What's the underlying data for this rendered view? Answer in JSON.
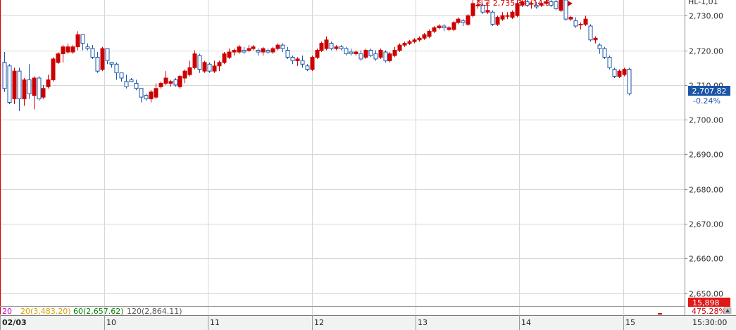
{
  "chart_data": {
    "type": "candlestick",
    "x_labels": [
      "02/03",
      "10",
      "11",
      "12",
      "13",
      "14",
      "15"
    ],
    "time_label": "15:30:00",
    "y_ticks": [
      "2,730.00",
      "2,720.00",
      "2,710.00",
      "2,700.00",
      "2,690.00",
      "2,680.00",
      "2,670.00",
      "2,660.00",
      "2,650.00"
    ],
    "y_tick_values": [
      2730,
      2720,
      2710,
      2700,
      2690,
      2680,
      2670,
      2660,
      2650
    ],
    "ylim": [
      2646.5,
      2734.5
    ],
    "high_annotation": "최고 2,735.34 (14:5",
    "top_right_label": "HL-1,01",
    "current_price": "2,707.82",
    "current_value": 2707.82,
    "change_pct": "-0.24%",
    "volume_value": "15,898",
    "volume_pct": "475.28%",
    "ma_legend": [
      {
        "label": "20",
        "color": "#cc00cc"
      },
      {
        "label": "20(3,483.20)",
        "color": "#d4a000"
      },
      {
        "label": "60(2,657.62)",
        "color": "#008000"
      },
      {
        "label": "120(2,864.11)",
        "color": "#555555"
      }
    ],
    "up_color": "#cc0000",
    "down_color": "#1a55a8",
    "candles": [
      [
        2716.5,
        2709.0,
        2719.5,
        2708.0
      ],
      [
        2715.5,
        2705.0,
        2716.0,
        2704.5
      ],
      [
        2706.0,
        2714.0,
        2715.0,
        2704.5
      ],
      [
        2714.0,
        2706.0,
        2715.0,
        2702.5
      ],
      [
        2706.0,
        2711.5,
        2712.0,
        2704.0
      ],
      [
        2711.5,
        2707.5,
        2716.0,
        2706.0
      ],
      [
        2707.0,
        2712.0,
        2712.5,
        2703.0
      ],
      [
        2712.0,
        2706.0,
        2712.5,
        2705.5
      ],
      [
        2706.5,
        2709.0,
        2710.0,
        2706.0
      ],
      [
        2709.5,
        2711.5,
        2713.0,
        2709.0
      ],
      [
        2711.5,
        2717.5,
        2718.0,
        2711.0
      ],
      [
        2716.5,
        2719.0,
        2719.5,
        2716.0
      ],
      [
        2719.0,
        2721.0,
        2721.5,
        2716.5
      ],
      [
        2719.5,
        2721.0,
        2722.0,
        2719.0
      ],
      [
        2719.5,
        2721.0,
        2721.5,
        2719.0
      ],
      [
        2721.0,
        2724.5,
        2725.5,
        2720.0
      ],
      [
        2724.5,
        2722.0,
        2724.5,
        2720.0
      ],
      [
        2721.0,
        2720.5,
        2722.0,
        2720.0
      ],
      [
        2720.5,
        2718.0,
        2721.5,
        2717.5
      ],
      [
        2718.0,
        2714.0,
        2719.5,
        2713.5
      ],
      [
        2714.5,
        2720.5,
        2721.0,
        2714.0
      ],
      [
        2720.5,
        2717.0,
        2720.5,
        2716.0
      ],
      [
        2716.5,
        2716.0,
        2716.5,
        2715.0
      ],
      [
        2716.0,
        2713.5,
        2716.5,
        2711.5
      ],
      [
        2713.5,
        2712.0,
        2713.5,
        2711.0
      ],
      [
        2711.0,
        2709.5,
        2713.0,
        2709.0
      ],
      [
        2711.5,
        2711.0,
        2712.0,
        2711.0
      ],
      [
        2710.5,
        2709.0,
        2711.5,
        2708.5
      ],
      [
        2709.0,
        2706.5,
        2709.0,
        2705.0
      ],
      [
        2707.0,
        2706.0,
        2707.5,
        2705.5
      ],
      [
        2706.0,
        2708.0,
        2708.5,
        2705.0
      ],
      [
        2706.5,
        2709.0,
        2710.5,
        2706.0
      ],
      [
        2709.5,
        2710.5,
        2711.0,
        2709.0
      ],
      [
        2710.5,
        2712.0,
        2714.0,
        2710.0
      ],
      [
        2710.5,
        2711.0,
        2711.5,
        2709.5
      ],
      [
        2711.5,
        2710.0,
        2712.0,
        2709.5
      ],
      [
        2709.5,
        2712.5,
        2713.0,
        2709.0
      ],
      [
        2712.0,
        2714.0,
        2714.5,
        2710.5
      ],
      [
        2713.0,
        2715.0,
        2717.0,
        2712.5
      ],
      [
        2715.0,
        2719.0,
        2720.0,
        2714.5
      ],
      [
        2718.5,
        2714.5,
        2719.0,
        2713.5
      ],
      [
        2714.0,
        2716.5,
        2717.0,
        2713.5
      ],
      [
        2716.0,
        2714.0,
        2716.5,
        2713.5
      ],
      [
        2714.0,
        2715.5,
        2717.0,
        2713.5
      ],
      [
        2715.5,
        2716.5,
        2717.0,
        2714.0
      ],
      [
        2716.5,
        2719.0,
        2719.5,
        2716.0
      ],
      [
        2718.0,
        2719.5,
        2720.5,
        2717.5
      ],
      [
        2719.5,
        2720.0,
        2720.5,
        2718.5
      ],
      [
        2719.5,
        2721.0,
        2721.5,
        2719.0
      ],
      [
        2720.0,
        2719.5,
        2721.0,
        2719.0
      ],
      [
        2720.0,
        2720.5,
        2721.5,
        2719.5
      ],
      [
        2720.5,
        2721.0,
        2721.5,
        2720.0
      ],
      [
        2720.0,
        2719.5,
        2720.5,
        2718.5
      ],
      [
        2719.5,
        2720.5,
        2721.0,
        2718.5
      ],
      [
        2720.0,
        2719.5,
        2720.5,
        2719.0
      ],
      [
        2719.5,
        2720.5,
        2721.0,
        2719.0
      ],
      [
        2720.5,
        2721.5,
        2722.0,
        2720.0
      ],
      [
        2721.5,
        2720.5,
        2722.0,
        2719.5
      ],
      [
        2720.0,
        2718.0,
        2721.0,
        2717.5
      ],
      [
        2718.0,
        2717.0,
        2718.5,
        2716.0
      ],
      [
        2717.0,
        2717.5,
        2718.0,
        2715.5
      ],
      [
        2717.0,
        2716.0,
        2718.5,
        2715.0
      ],
      [
        2715.5,
        2714.5,
        2716.0,
        2714.0
      ],
      [
        2714.5,
        2718.0,
        2718.5,
        2714.0
      ],
      [
        2718.0,
        2720.0,
        2720.5,
        2717.5
      ],
      [
        2720.0,
        2722.0,
        2722.5,
        2719.5
      ],
      [
        2720.5,
        2723.0,
        2724.0,
        2720.0
      ],
      [
        2722.0,
        2720.5,
        2722.5,
        2720.0
      ],
      [
        2720.5,
        2721.0,
        2721.5,
        2720.0
      ],
      [
        2721.0,
        2720.5,
        2721.5,
        2720.0
      ],
      [
        2720.5,
        2719.0,
        2721.0,
        2718.5
      ],
      [
        2719.5,
        2719.0,
        2720.5,
        2718.5
      ],
      [
        2719.0,
        2719.5,
        2720.0,
        2718.5
      ],
      [
        2719.0,
        2717.5,
        2720.0,
        2717.0
      ],
      [
        2718.0,
        2720.0,
        2720.5,
        2717.5
      ],
      [
        2720.0,
        2718.5,
        2720.5,
        2718.0
      ],
      [
        2719.0,
        2717.5,
        2720.0,
        2717.0
      ],
      [
        2718.0,
        2720.0,
        2720.5,
        2717.5
      ],
      [
        2719.5,
        2717.0,
        2720.0,
        2716.5
      ],
      [
        2717.0,
        2719.0,
        2719.5,
        2716.5
      ],
      [
        2718.5,
        2720.0,
        2721.0,
        2718.0
      ],
      [
        2720.0,
        2721.5,
        2722.0,
        2719.5
      ],
      [
        2721.5,
        2722.0,
        2722.5,
        2721.0
      ],
      [
        2722.0,
        2722.5,
        2723.0,
        2721.5
      ],
      [
        2722.5,
        2723.0,
        2723.5,
        2722.0
      ],
      [
        2723.0,
        2723.5,
        2724.0,
        2722.5
      ],
      [
        2723.5,
        2724.5,
        2725.0,
        2723.0
      ],
      [
        2724.0,
        2725.5,
        2726.0,
        2723.5
      ],
      [
        2725.5,
        2726.5,
        2727.0,
        2725.0
      ],
      [
        2726.5,
        2727.0,
        2727.5,
        2726.0
      ],
      [
        2727.0,
        2726.5,
        2727.5,
        2725.5
      ],
      [
        2726.0,
        2726.5,
        2727.0,
        2725.5
      ],
      [
        2726.0,
        2728.0,
        2728.5,
        2725.5
      ],
      [
        2728.0,
        2729.0,
        2729.5,
        2727.5
      ],
      [
        2728.5,
        2728.0,
        2729.0,
        2727.0
      ],
      [
        2727.5,
        2730.0,
        2730.5,
        2727.0
      ],
      [
        2730.0,
        2733.5,
        2734.5,
        2729.5
      ],
      [
        2733.0,
        2733.0,
        2735.0,
        2732.0
      ],
      [
        2733.0,
        2731.0,
        2733.5,
        2730.5
      ],
      [
        2731.0,
        2731.5,
        2734.0,
        2730.5
      ],
      [
        2731.0,
        2727.5,
        2731.5,
        2727.0
      ],
      [
        2727.5,
        2729.5,
        2730.0,
        2727.0
      ],
      [
        2729.0,
        2730.0,
        2731.0,
        2728.5
      ],
      [
        2730.0,
        2730.0,
        2731.0,
        2729.0
      ],
      [
        2729.5,
        2731.0,
        2731.5,
        2729.0
      ],
      [
        2730.0,
        2733.5,
        2734.5,
        2729.5
      ],
      [
        2733.0,
        2734.0,
        2735.0,
        2732.5
      ],
      [
        2734.0,
        2733.0,
        2735.3,
        2732.5
      ],
      [
        2733.5,
        2733.5,
        2734.0,
        2732.0
      ],
      [
        2733.0,
        2732.5,
        2734.0,
        2732.0
      ],
      [
        2733.0,
        2733.5,
        2734.0,
        2732.5
      ],
      [
        2733.5,
        2734.0,
        2734.5,
        2733.0
      ],
      [
        2734.0,
        2733.0,
        2734.5,
        2732.5
      ],
      [
        2734.0,
        2732.0,
        2734.5,
        2731.5
      ],
      [
        2731.5,
        2734.5,
        2735.0,
        2731.0
      ],
      [
        2734.5,
        2729.0,
        2735.0,
        2728.5
      ],
      [
        2729.0,
        2729.5,
        2730.0,
        2728.5
      ],
      [
        2728.5,
        2727.0,
        2729.5,
        2726.5
      ],
      [
        2727.5,
        2727.5,
        2728.0,
        2726.0
      ],
      [
        2727.5,
        2729.0,
        2730.0,
        2727.0
      ],
      [
        2727.0,
        2723.0,
        2727.5,
        2722.5
      ],
      [
        2723.0,
        2723.5,
        2724.0,
        2722.0
      ],
      [
        2721.5,
        2720.5,
        2722.0,
        2719.0
      ],
      [
        2720.5,
        2718.0,
        2721.0,
        2717.5
      ],
      [
        2718.0,
        2715.0,
        2718.5,
        2714.5
      ],
      [
        2714.5,
        2712.5,
        2715.0,
        2712.0
      ],
      [
        2712.5,
        2714.0,
        2714.5,
        2712.0
      ],
      [
        2713.0,
        2714.5,
        2715.0,
        2712.5
      ],
      [
        2714.5,
        2707.5,
        2715.0,
        2707.0
      ]
    ]
  }
}
